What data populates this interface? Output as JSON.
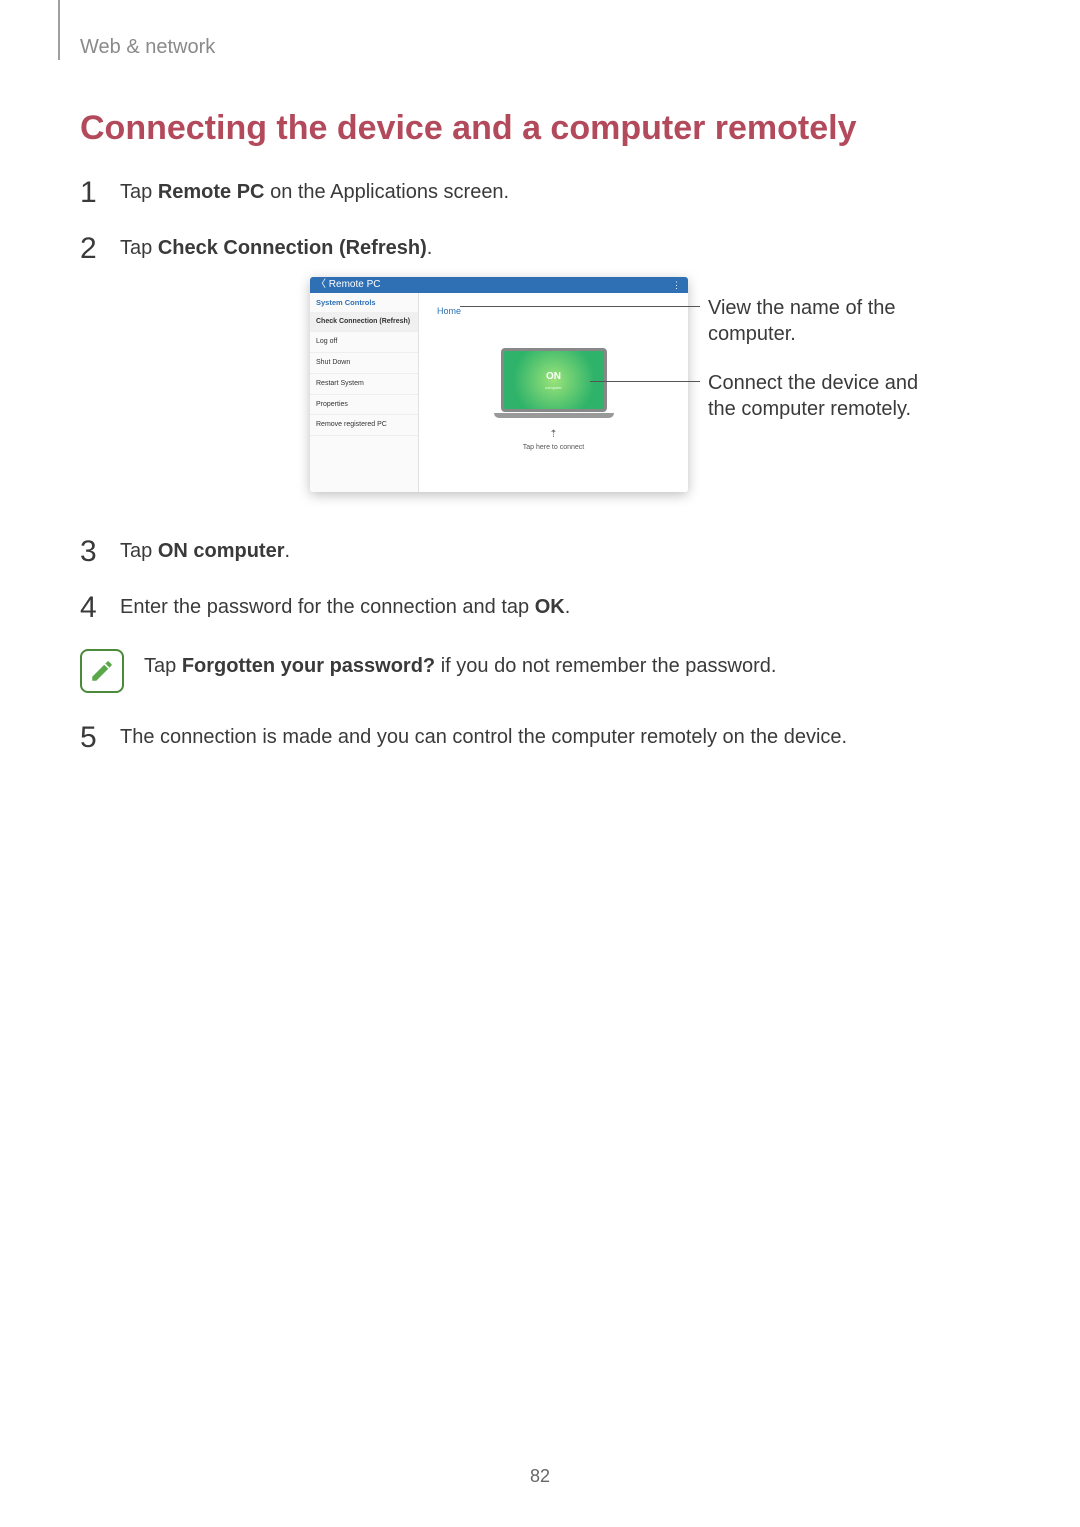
{
  "breadcrumb": "Web & network",
  "heading": "Connecting the device and a computer remotely",
  "steps": {
    "s1": {
      "num": "1",
      "pre": "Tap ",
      "bold": "Remote PC",
      "post": " on the Applications screen."
    },
    "s2": {
      "num": "2",
      "pre": "Tap ",
      "bold": "Check Connection (Refresh)",
      "post": "."
    },
    "s3": {
      "num": "3",
      "pre": "Tap ",
      "bold": "ON computer",
      "post": "."
    },
    "s4": {
      "num": "4",
      "pre": "Enter the password for the connection and tap ",
      "bold": "OK",
      "post": "."
    },
    "s5": {
      "num": "5",
      "pre": "The connection is made and you can control the computer remotely on the device.",
      "bold": "",
      "post": ""
    }
  },
  "note": {
    "pre": "Tap ",
    "bold": "Forgotten your password?",
    "post": " if you do not remember the password."
  },
  "screenshot": {
    "title_back": "Remote PC",
    "menu_dots": "⋮",
    "sidebar_header": "System Controls",
    "sidebar_items": {
      "i0": "Check Connection (Refresh)",
      "i1": "Log off",
      "i2": "Shut Down",
      "i3": "Restart System",
      "i4": "Properties",
      "i5": "Remove registered PC"
    },
    "home_label": "Home",
    "on_label": "ON",
    "on_sub": "computer",
    "arrow_glyph": "⇡",
    "tap_text": "Tap here to connect"
  },
  "callouts": {
    "c1": "View the name of the computer.",
    "c2": "Connect the device and the computer remotely."
  },
  "page_number": "82"
}
